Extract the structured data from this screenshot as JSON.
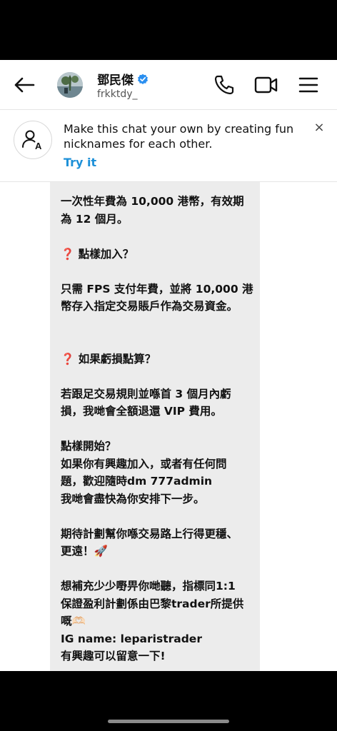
{
  "header": {
    "display_name": "鄧民傑",
    "username": "frkktdy_"
  },
  "icons": {
    "back": "arrow-left-icon",
    "call": "phone-icon",
    "video": "video-camera-icon",
    "menu": "hamburger-menu-icon",
    "verified": "verified-badge-icon",
    "nickname": "person-a-icon",
    "close": "close-icon"
  },
  "banner": {
    "text": "Make this chat your own by creating fun nicknames for each other.",
    "cta": "Try it",
    "close_label": "×"
  },
  "colors": {
    "accent": "#1d90d8",
    "verified": "#2a8ff0",
    "bubble": "#ececec"
  },
  "message": {
    "text": "一次性年費為 10,000 港幣，有效期\n為 12 個月。\n\n❓ 點樣加入？\n\n只需 FPS 支付年費，並將 10,000 港\n幣存入指定交易賬戶作為交易資金。\n\n\n❓ 如果虧損點算？\n\n若跟足交易規則並喺首 3 個月內虧\n損，我哋會全額退還 VIP 費用。\n\n點樣開始？\n如果你有興趣加入，或者有任何問\n題，歡迎隨時dm 777admin\n我哋會盡快為你安排下一步。\n\n期待計劃幫你喺交易路上行得更穩、\n更遠！🚀\n\n想補充少少嘢畀你哋聽，指標同1:1\n保證盈利計劃係由巴黎trader所提供\n嘅🫶🏻\nIG name: leparistrader\n有興趣可以留意一下!\n\n有好多人問指標究竟係點用，呢個係"
  }
}
